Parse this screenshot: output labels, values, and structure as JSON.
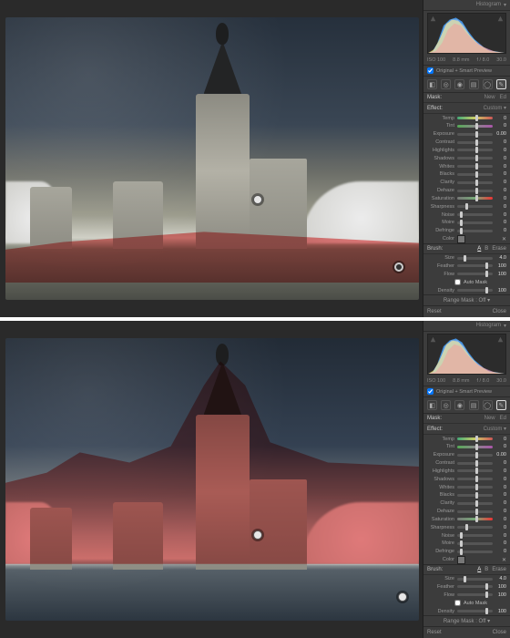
{
  "panels": [
    {
      "histogram_title": "Histogram",
      "meta": {
        "iso": "ISO 100",
        "focal": "8.8 mm",
        "aperture": "f / 8.0",
        "shutter": "30.0"
      },
      "original_preview": "Original + Smart Preview",
      "pin": {
        "left": "60%",
        "top": "63%"
      },
      "pin2": {
        "left": "94%",
        "top": "87%",
        "dark": true
      }
    },
    {
      "histogram_title": "Histogram",
      "meta": {
        "iso": "ISO 100",
        "focal": "8.8 mm",
        "aperture": "f / 8.0",
        "shutter": "30.0"
      },
      "original_preview": "Original + Smart Preview",
      "pin": {
        "left": "60%",
        "top": "68%"
      },
      "pin2": {
        "left": "95%",
        "top": "90%"
      }
    }
  ],
  "mask_header": {
    "label": "Mask:",
    "new": "New",
    "edit": "Ed"
  },
  "effect_header": {
    "label": "Effect:",
    "value": "Custom"
  },
  "sliders": [
    {
      "name": "Temp",
      "klass": "temp",
      "pos": 50,
      "val": "0"
    },
    {
      "name": "Tint",
      "klass": "tint",
      "pos": 50,
      "val": "0"
    },
    {
      "name": "Exposure",
      "klass": "",
      "pos": 50,
      "val": "0.00"
    },
    {
      "name": "Contrast",
      "klass": "",
      "pos": 50,
      "val": "0"
    },
    {
      "name": "Highlights",
      "klass": "",
      "pos": 50,
      "val": "0"
    },
    {
      "name": "Shadows",
      "klass": "",
      "pos": 50,
      "val": "0"
    },
    {
      "name": "Whites",
      "klass": "",
      "pos": 50,
      "val": "0"
    },
    {
      "name": "Blacks",
      "klass": "",
      "pos": 50,
      "val": "0"
    },
    {
      "name": "Clarity",
      "klass": "",
      "pos": 50,
      "val": "0"
    },
    {
      "name": "Dehaze",
      "klass": "",
      "pos": 50,
      "val": "0"
    },
    {
      "name": "Saturation",
      "klass": "sat",
      "pos": 50,
      "val": "0"
    },
    {
      "name": "Sharpness",
      "klass": "",
      "pos": 22,
      "val": "0"
    },
    {
      "name": "Noise",
      "klass": "",
      "pos": 8,
      "val": "0"
    },
    {
      "name": "Moire",
      "klass": "",
      "pos": 8,
      "val": "0"
    },
    {
      "name": "Defringe",
      "klass": "",
      "pos": 8,
      "val": "0"
    }
  ],
  "color_row": {
    "label": "Color"
  },
  "brush": {
    "label": "Brush:",
    "a": "A",
    "b": "B",
    "erase": "Erase",
    "sliders": [
      {
        "name": "Size",
        "pos": 18,
        "val": "4.0"
      },
      {
        "name": "Feather",
        "pos": 80,
        "val": "100"
      },
      {
        "name": "Flow",
        "pos": 80,
        "val": "100"
      },
      {
        "name": "Density",
        "pos": 80,
        "val": "100"
      }
    ],
    "automask": "Auto Mask"
  },
  "range_mask": {
    "label": "Range Mask :",
    "value": "Off"
  },
  "footer": {
    "reset": "Reset",
    "close": "Close"
  },
  "tools": [
    "crop",
    "spot",
    "eye",
    "grad",
    "radial",
    "brush"
  ]
}
